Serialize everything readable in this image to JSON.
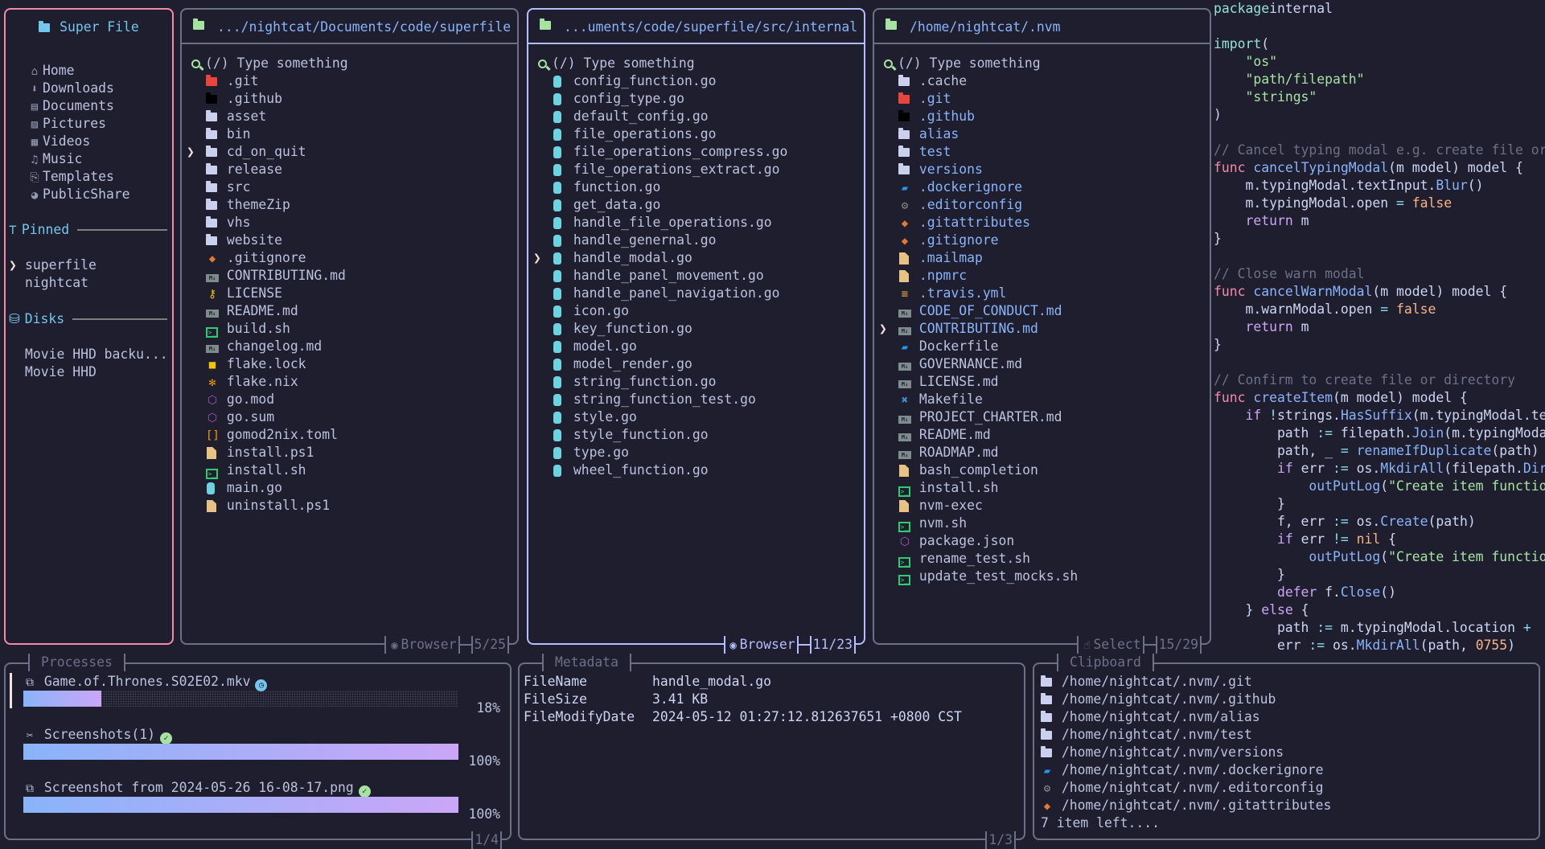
{
  "sidebar": {
    "title": "Super File",
    "title_icon": "folder-icon",
    "well_known": [
      {
        "label": "Home",
        "icon": "home"
      },
      {
        "label": "Downloads",
        "icon": "download"
      },
      {
        "label": "Documents",
        "icon": "document"
      },
      {
        "label": "Pictures",
        "icon": "picture"
      },
      {
        "label": "Videos",
        "icon": "video"
      },
      {
        "label": "Music",
        "icon": "music"
      },
      {
        "label": "Templates",
        "icon": "paperclip"
      },
      {
        "label": "PublicShare",
        "icon": "globe"
      }
    ],
    "pinned_heading": "Pinned",
    "pinned": [
      {
        "label": "superfile",
        "cursor": true
      },
      {
        "label": "nightcat"
      }
    ],
    "disks_heading": "Disks",
    "disks": [
      {
        "label": "Movie HHD backu..."
      },
      {
        "label": "Movie HHD"
      }
    ]
  },
  "panels": [
    {
      "path": ".../nightcat/Documents/code/superfile",
      "search_placeholder": "(/) Type something",
      "mode": "Browser",
      "mode_icon": "eye",
      "position": "5/25",
      "focused": false,
      "items": [
        {
          "name": ".git",
          "icon": "folder-git"
        },
        {
          "name": ".github",
          "icon": "folder-github"
        },
        {
          "name": "asset",
          "icon": "folder"
        },
        {
          "name": "bin",
          "icon": "folder"
        },
        {
          "name": "cd_on_quit",
          "icon": "folder",
          "cursor": true
        },
        {
          "name": "release",
          "icon": "folder"
        },
        {
          "name": "src",
          "icon": "folder"
        },
        {
          "name": "themeZip",
          "icon": "folder"
        },
        {
          "name": "vhs",
          "icon": "folder"
        },
        {
          "name": "website",
          "icon": "folder"
        },
        {
          "name": ".gitignore",
          "icon": "git"
        },
        {
          "name": "CONTRIBUTING.md",
          "icon": "markdown"
        },
        {
          "name": "LICENSE",
          "icon": "key"
        },
        {
          "name": "README.md",
          "icon": "markdown"
        },
        {
          "name": "build.sh",
          "icon": "shell"
        },
        {
          "name": "changelog.md",
          "icon": "markdown"
        },
        {
          "name": "flake.lock",
          "icon": "lock"
        },
        {
          "name": "flake.nix",
          "icon": "nix"
        },
        {
          "name": "go.mod",
          "icon": "package"
        },
        {
          "name": "go.sum",
          "icon": "package"
        },
        {
          "name": "gomod2nix.toml",
          "icon": "toml"
        },
        {
          "name": "install.ps1",
          "icon": "file"
        },
        {
          "name": "install.sh",
          "icon": "shell"
        },
        {
          "name": "main.go",
          "icon": "go"
        },
        {
          "name": "uninstall.ps1",
          "icon": "file"
        }
      ]
    },
    {
      "path": "...uments/code/superfile/src/internal",
      "search_placeholder": "(/) Type something",
      "mode": "Browser",
      "mode_icon": "eye",
      "position": "11/23",
      "focused": true,
      "items": [
        {
          "name": "config_function.go",
          "icon": "go"
        },
        {
          "name": "config_type.go",
          "icon": "go"
        },
        {
          "name": "default_config.go",
          "icon": "go"
        },
        {
          "name": "file_operations.go",
          "icon": "go"
        },
        {
          "name": "file_operations_compress.go",
          "icon": "go"
        },
        {
          "name": "file_operations_extract.go",
          "icon": "go"
        },
        {
          "name": "function.go",
          "icon": "go"
        },
        {
          "name": "get_data.go",
          "icon": "go"
        },
        {
          "name": "handle_file_operations.go",
          "icon": "go"
        },
        {
          "name": "handle_genernal.go",
          "icon": "go"
        },
        {
          "name": "handle_modal.go",
          "icon": "go",
          "cursor": true
        },
        {
          "name": "handle_panel_movement.go",
          "icon": "go"
        },
        {
          "name": "handle_panel_navigation.go",
          "icon": "go"
        },
        {
          "name": "icon.go",
          "icon": "go"
        },
        {
          "name": "key_function.go",
          "icon": "go"
        },
        {
          "name": "model.go",
          "icon": "go"
        },
        {
          "name": "model_render.go",
          "icon": "go"
        },
        {
          "name": "string_function.go",
          "icon": "go"
        },
        {
          "name": "string_function_test.go",
          "icon": "go"
        },
        {
          "name": "style.go",
          "icon": "go"
        },
        {
          "name": "style_function.go",
          "icon": "go"
        },
        {
          "name": "type.go",
          "icon": "go"
        },
        {
          "name": "wheel_function.go",
          "icon": "go"
        }
      ]
    },
    {
      "path": "/home/nightcat/.nvm",
      "search_placeholder": "(/) Type something",
      "mode": "Select",
      "mode_icon": "hand",
      "position": "15/29",
      "focused": false,
      "items": [
        {
          "name": ".cache",
          "icon": "folder"
        },
        {
          "name": ".git",
          "icon": "folder-git",
          "selected": true
        },
        {
          "name": ".github",
          "icon": "folder-github",
          "selected": true
        },
        {
          "name": "alias",
          "icon": "folder",
          "selected": true
        },
        {
          "name": "test",
          "icon": "folder",
          "selected": true
        },
        {
          "name": "versions",
          "icon": "folder",
          "selected": true
        },
        {
          "name": ".dockerignore",
          "icon": "docker",
          "selected": true
        },
        {
          "name": ".editorconfig",
          "icon": "gear",
          "selected": true
        },
        {
          "name": ".gitattributes",
          "icon": "git",
          "selected": true
        },
        {
          "name": ".gitignore",
          "icon": "git",
          "selected": true
        },
        {
          "name": ".mailmap",
          "icon": "file",
          "selected": true
        },
        {
          "name": ".npmrc",
          "icon": "file",
          "selected": true
        },
        {
          "name": ".travis.yml",
          "icon": "yml",
          "selected": true
        },
        {
          "name": "CODE_OF_CONDUCT.md",
          "icon": "markdown",
          "selected": true
        },
        {
          "name": "CONTRIBUTING.md",
          "icon": "markdown",
          "selected": true,
          "cursor": true
        },
        {
          "name": "Dockerfile",
          "icon": "docker"
        },
        {
          "name": "GOVERNANCE.md",
          "icon": "markdown"
        },
        {
          "name": "LICENSE.md",
          "icon": "markdown"
        },
        {
          "name": "Makefile",
          "icon": "wrench"
        },
        {
          "name": "PROJECT_CHARTER.md",
          "icon": "markdown"
        },
        {
          "name": "README.md",
          "icon": "markdown"
        },
        {
          "name": "ROADMAP.md",
          "icon": "markdown"
        },
        {
          "name": "bash_completion",
          "icon": "file"
        },
        {
          "name": "install.sh",
          "icon": "shell"
        },
        {
          "name": "nvm-exec",
          "icon": "file"
        },
        {
          "name": "nvm.sh",
          "icon": "shell"
        },
        {
          "name": "package.json",
          "icon": "package"
        },
        {
          "name": "rename_test.sh",
          "icon": "shell"
        },
        {
          "name": "update_test_mocks.sh",
          "icon": "shell"
        }
      ]
    }
  ],
  "preview": {
    "lines": [
      [
        [
          "k-teal",
          "package"
        ],
        [
          "",
          "internal"
        ]
      ],
      [],
      [
        [
          "k-teal",
          "import"
        ],
        [
          "",
          "("
        ]
      ],
      [
        [
          "",
          "    "
        ],
        [
          "k-str",
          "\"os\""
        ]
      ],
      [
        [
          "",
          "    "
        ],
        [
          "k-str",
          "\"path/filepath\""
        ]
      ],
      [
        [
          "",
          "    "
        ],
        [
          "k-str",
          "\"strings\""
        ]
      ],
      [
        [
          "",
          ")"
        ]
      ],
      [],
      [
        [
          "k-cm",
          "// Cancel typing modal e.g. create file or directory"
        ]
      ],
      [
        [
          "k-red",
          "func"
        ],
        [
          "",
          " "
        ],
        [
          "k-fn",
          "cancelTypingModal"
        ],
        [
          "",
          "(m model) model {"
        ]
      ],
      [
        [
          "",
          "    m.typingModal.textInput."
        ],
        [
          "k-fn",
          "Blur"
        ],
        [
          "",
          "()"
        ]
      ],
      [
        [
          "",
          "    m.typingModal.open "
        ],
        [
          "k-op",
          "="
        ],
        [
          "",
          " "
        ],
        [
          "k-num",
          "false"
        ]
      ],
      [
        [
          "",
          "    "
        ],
        [
          "k-kw",
          "return"
        ],
        [
          "",
          " m"
        ]
      ],
      [
        [
          "",
          "}"
        ]
      ],
      [],
      [
        [
          "k-cm",
          "// Close warn modal"
        ]
      ],
      [
        [
          "k-red",
          "func"
        ],
        [
          "",
          " "
        ],
        [
          "k-fn",
          "cancelWarnModal"
        ],
        [
          "",
          "(m model) model {"
        ]
      ],
      [
        [
          "",
          "    m.warnModal.open "
        ],
        [
          "k-op",
          "="
        ],
        [
          "",
          " "
        ],
        [
          "k-num",
          "false"
        ]
      ],
      [
        [
          "",
          "    "
        ],
        [
          "k-kw",
          "return"
        ],
        [
          "",
          " m"
        ]
      ],
      [
        [
          "",
          "}"
        ]
      ],
      [],
      [
        [
          "k-cm",
          "// Confirm to create file or directory"
        ]
      ],
      [
        [
          "k-red",
          "func"
        ],
        [
          "",
          " "
        ],
        [
          "k-fn",
          "createItem"
        ],
        [
          "",
          "(m model) model {"
        ]
      ],
      [
        [
          "",
          "    "
        ],
        [
          "k-kw",
          "if"
        ],
        [
          "",
          " "
        ],
        [
          "k-op",
          "!"
        ],
        [
          "",
          "strings."
        ],
        [
          "k-fn",
          "HasSuffix"
        ],
        [
          "",
          "(m.typingModal.textInput.Value()"
        ]
      ],
      [
        [
          "",
          "        path "
        ],
        [
          "k-op",
          ":="
        ],
        [
          "",
          " filepath."
        ],
        [
          "k-fn",
          "Join"
        ],
        [
          "",
          "(m.typingModal.location"
        ]
      ],
      [
        [
          "",
          "        path, _ "
        ],
        [
          "k-op",
          "="
        ],
        [
          "",
          " "
        ],
        [
          "k-fn",
          "renameIfDuplicate"
        ],
        [
          "",
          "(path)"
        ]
      ],
      [
        [
          "",
          "        "
        ],
        [
          "k-kw",
          "if"
        ],
        [
          "",
          " err "
        ],
        [
          "k-op",
          ":="
        ],
        [
          "",
          " os."
        ],
        [
          "k-fn",
          "MkdirAll"
        ],
        [
          "",
          "(filepath."
        ],
        [
          "k-fn",
          "Dir"
        ],
        [
          "",
          "(path)"
        ]
      ],
      [
        [
          "",
          "            "
        ],
        [
          "k-fn",
          "outPutLog"
        ],
        [
          "",
          "("
        ],
        [
          "k-str",
          "\"Create item function error\""
        ]
      ],
      [
        [
          "",
          "        }"
        ]
      ],
      [
        [
          "",
          "        f, err "
        ],
        [
          "k-op",
          ":="
        ],
        [
          "",
          " os."
        ],
        [
          "k-fn",
          "Create"
        ],
        [
          "",
          "(path)"
        ]
      ],
      [
        [
          "",
          "        "
        ],
        [
          "k-kw",
          "if"
        ],
        [
          "",
          " err "
        ],
        [
          "k-op",
          "!="
        ],
        [
          "",
          " "
        ],
        [
          "k-num",
          "nil"
        ],
        [
          "",
          " {"
        ]
      ],
      [
        [
          "",
          "            "
        ],
        [
          "k-fn",
          "outPutLog"
        ],
        [
          "",
          "("
        ],
        [
          "k-str",
          "\"Create item function error\""
        ]
      ],
      [
        [
          "",
          "        }"
        ]
      ],
      [
        [
          "",
          "        "
        ],
        [
          "k-kw",
          "defer"
        ],
        [
          "",
          " f."
        ],
        [
          "k-fn",
          "Close"
        ],
        [
          "",
          "()"
        ]
      ],
      [
        [
          "",
          "    } "
        ],
        [
          "k-kw",
          "else"
        ],
        [
          "",
          " {"
        ]
      ],
      [
        [
          "",
          "        path "
        ],
        [
          "k-op",
          ":="
        ],
        [
          "",
          " m.typingModal.location "
        ],
        [
          "k-op",
          "+"
        ]
      ],
      [
        [
          "",
          "        err "
        ],
        [
          "k-op",
          ":="
        ],
        [
          "",
          " os."
        ],
        [
          "k-fn",
          "MkdirAll"
        ],
        [
          "",
          "(path, "
        ],
        [
          "k-num",
          "0755"
        ],
        [
          "",
          ")"
        ]
      ]
    ]
  },
  "processes": {
    "title": "Processes",
    "position": "1/4",
    "items": [
      {
        "name": "Game.of.Thrones.S02E02.mkv",
        "icon": "copy",
        "status": "in-progress",
        "progress": 18,
        "label": "18%",
        "cursor": true
      },
      {
        "name": "Screenshots(1)",
        "icon": "scissors",
        "status": "done",
        "progress": 100,
        "label": "100%"
      },
      {
        "name": "Screenshot from 2024-05-26 16-08-17.png",
        "icon": "copy",
        "status": "done",
        "progress": 100,
        "label": "100%"
      }
    ]
  },
  "metadata": {
    "title": "Metadata",
    "position": "1/3",
    "rows": [
      {
        "key": "FileName",
        "value": "handle_modal.go"
      },
      {
        "key": "FileSize",
        "value": "3.41 KB"
      },
      {
        "key": "FileModifyDate",
        "value": "2024-05-12 01:27:12.812637651 +0800 CST"
      }
    ]
  },
  "clipboard": {
    "title": "Clipboard",
    "items": [
      {
        "path": "/home/nightcat/.nvm/.git",
        "icon": "folder"
      },
      {
        "path": "/home/nightcat/.nvm/.github",
        "icon": "folder"
      },
      {
        "path": "/home/nightcat/.nvm/alias",
        "icon": "folder"
      },
      {
        "path": "/home/nightcat/.nvm/test",
        "icon": "folder"
      },
      {
        "path": "/home/nightcat/.nvm/versions",
        "icon": "folder"
      },
      {
        "path": "/home/nightcat/.nvm/.dockerignore",
        "icon": "docker"
      },
      {
        "path": "/home/nightcat/.nvm/.editorconfig",
        "icon": "gear"
      },
      {
        "path": "/home/nightcat/.nvm/.gitattributes",
        "icon": "git"
      }
    ],
    "more": "7 item left...."
  },
  "colors": {
    "background": "#1e1e2e",
    "sidebar_border": "#f38ba8",
    "focused_border": "#b4befe",
    "border": "#6c7086",
    "path": "#89b4fa",
    "heading": "#74c7ec",
    "selected": "#89b4fa",
    "progress_start": "#89b4fa",
    "progress_end": "#cba6f7"
  }
}
